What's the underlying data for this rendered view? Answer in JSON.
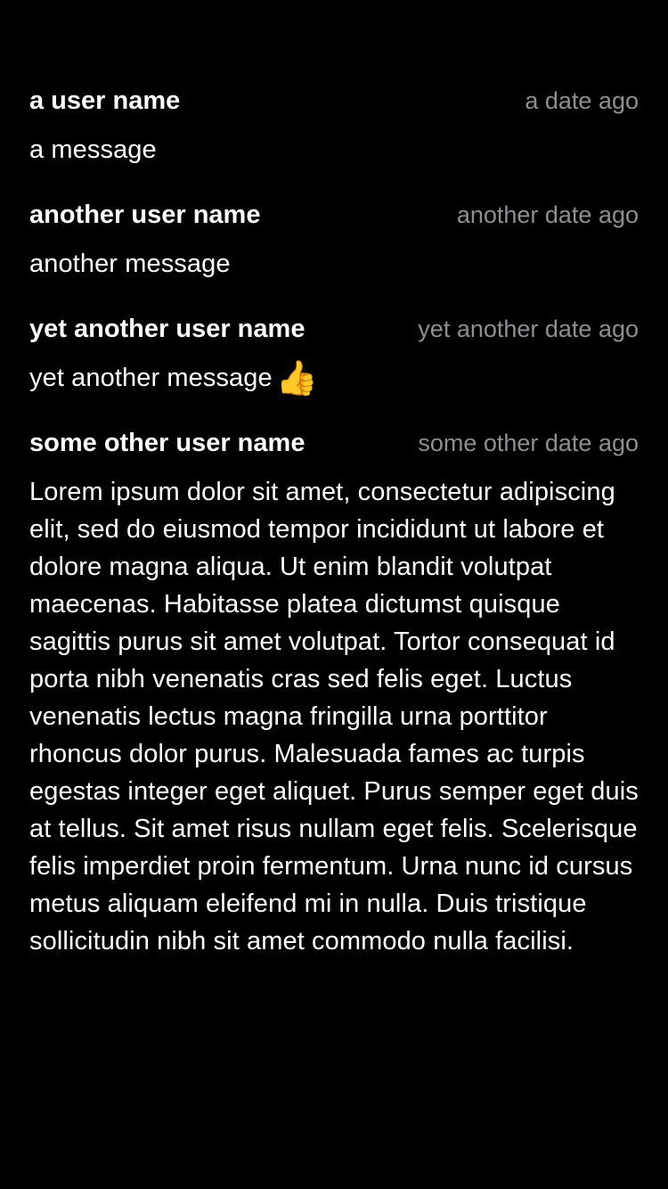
{
  "comments": [
    {
      "user_name": "a user name",
      "timestamp": "a date ago",
      "message": "a message"
    },
    {
      "user_name": "another user name",
      "timestamp": "another date ago",
      "message": "another message"
    },
    {
      "user_name": "yet another user name",
      "timestamp": "yet another date ago",
      "message": "yet another message",
      "emoji": "👍"
    },
    {
      "user_name": "some other user name",
      "timestamp": "some other date ago",
      "message": "Lorem ipsum dolor sit amet, consectetur adipiscing elit, sed do eiusmod tempor incididunt ut labore et dolore magna aliqua. Ut enim blandit volutpat maecenas. Habitasse platea dictumst quisque sagittis purus sit amet volutpat. Tortor consequat id porta nibh venenatis cras sed felis eget. Luctus venenatis lectus magna fringilla urna porttitor rhoncus dolor purus. Malesuada fames ac turpis egestas integer eget aliquet. Purus semper eget duis at tellus. Sit amet risus nullam eget felis. Scelerisque felis imperdiet proin fermentum. Urna nunc id cursus metus aliquam eleifend mi in nulla. Duis tristique sollicitudin nibh sit amet commodo nulla facilisi."
    }
  ]
}
